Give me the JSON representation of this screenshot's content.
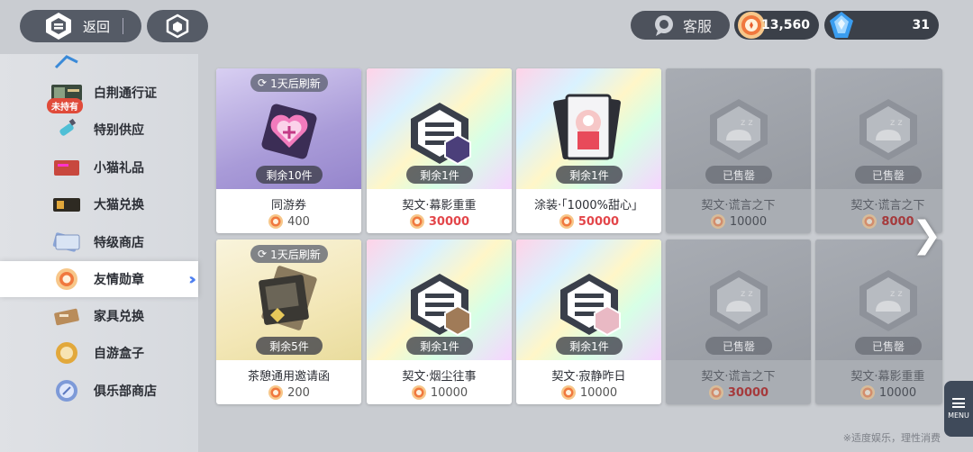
{
  "header": {
    "back_label": "返回",
    "service_label": "客服",
    "medal_count": "13,560",
    "gem_count": "31"
  },
  "sidebar": {
    "items": [
      {
        "label": "白荆通行证",
        "badge": "未持有"
      },
      {
        "label": "特别供应"
      },
      {
        "label": "小猫礼品"
      },
      {
        "label": "大猫兑换"
      },
      {
        "label": "特级商店"
      },
      {
        "label": "友情勋章",
        "active": true
      },
      {
        "label": "家具兑换"
      },
      {
        "label": "自游盒子"
      },
      {
        "label": "俱乐部商店"
      }
    ]
  },
  "cards": [
    {
      "name": "同游券",
      "price": "400",
      "remain": "剩余10件",
      "refresh": "1天后刷新"
    },
    {
      "name": "契文·幕影重重",
      "price": "30000",
      "remain": "剩余1件"
    },
    {
      "name": "涂装·「1000%甜心」",
      "price": "50000",
      "remain": "剩余1件"
    },
    {
      "name": "契文·谎言之下",
      "price": "10000",
      "remain": "已售罄"
    },
    {
      "name": "契文·谎言之下",
      "price": "8000",
      "remain": "已售罄"
    },
    {
      "name": "茶憩通用邀请函",
      "price": "200",
      "remain": "剩余5件",
      "refresh": "1天后刷新"
    },
    {
      "name": "契文·烟尘往事",
      "price": "10000",
      "remain": "剩余1件"
    },
    {
      "name": "契文·寂静昨日",
      "price": "10000",
      "remain": "剩余1件"
    },
    {
      "name": "契文·谎言之下",
      "price": "30000",
      "remain": "已售罄"
    },
    {
      "name": "契文·幕影重重",
      "price": "10000",
      "remain": "已售罄"
    }
  ],
  "menu_label": "MENU",
  "footer_note": "※适度娱乐，理性消费"
}
